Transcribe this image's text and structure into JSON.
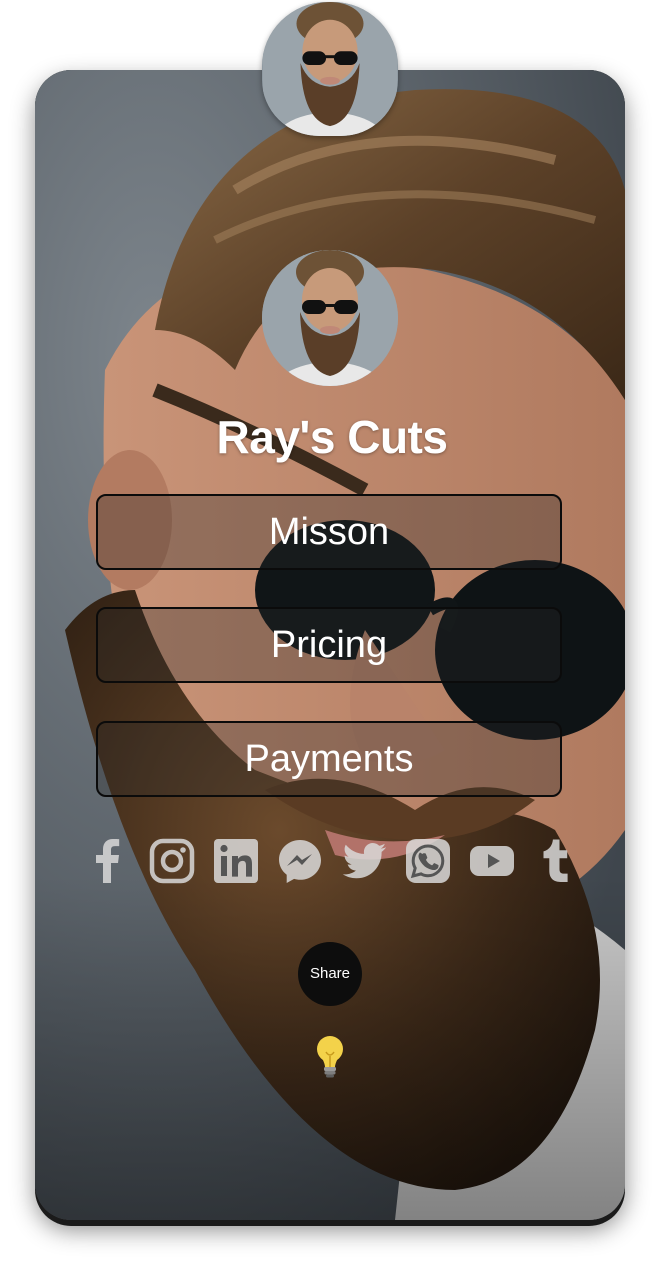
{
  "profile": {
    "name": "Ray's Cuts"
  },
  "buttons": [
    {
      "label": "Misson"
    },
    {
      "label": "Pricing"
    },
    {
      "label": "Payments"
    }
  ],
  "social_icons": [
    "facebook-icon",
    "instagram-icon",
    "linkedin-icon",
    "messenger-icon",
    "twitter-icon",
    "whatsapp-icon",
    "youtube-icon",
    "tumblr-icon"
  ],
  "share": {
    "label": "Share"
  },
  "colors": {
    "icon_fill": "#d9d9d9",
    "button_border": "#0b0b0b",
    "share_bg": "#0d0d0d",
    "bulb": "#e8c840"
  }
}
